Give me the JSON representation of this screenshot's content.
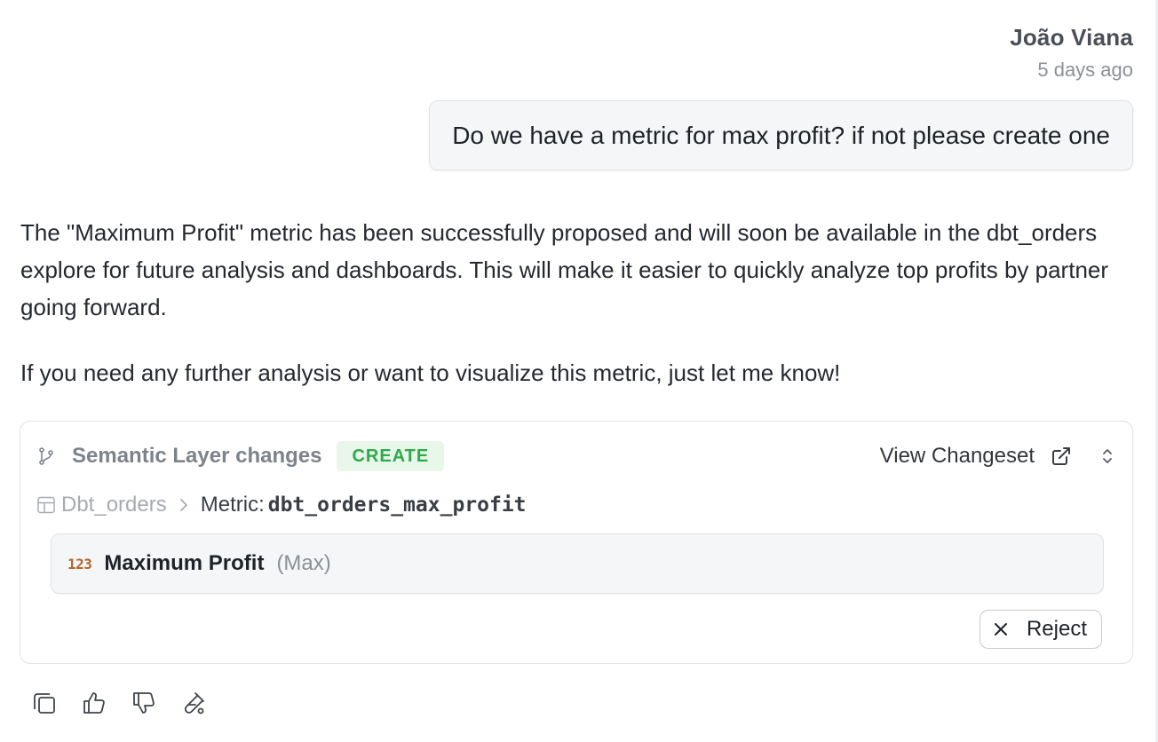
{
  "user_message": {
    "author": "João Viana",
    "timestamp": "5 days ago",
    "text": "Do we have a metric for max profit? if not please create one"
  },
  "assistant_message": {
    "paragraphs": [
      "The \"Maximum Profit\" metric has been successfully proposed and will soon be available in the dbt_orders explore for future analysis and dashboards. This will make it easier to quickly analyze top profits by partner going forward.",
      "If you need any further analysis or want to visualize this metric, just let me know!"
    ]
  },
  "changes_card": {
    "title": "Semantic Layer changes",
    "badge": "CREATE",
    "view_changeset_label": "View Changeset",
    "breadcrumb": {
      "model": "Dbt_orders",
      "kind": "Metric:",
      "name": "dbt_orders_max_profit"
    },
    "metric": {
      "type_icon": "123",
      "label": "Maximum Profit",
      "aggregation": "(Max)"
    },
    "reject_label": "Reject"
  },
  "icons": {
    "branch": "git-branch-icon",
    "external_link": "external-link-icon",
    "expand": "chevron-up-down-icon",
    "table": "table-icon",
    "breadcrumb_separator": "chevron-right-icon",
    "reject": "close-icon",
    "actions": [
      "copy-icon",
      "thumbs-up-icon",
      "thumbs-down-icon",
      "flask-icon"
    ]
  },
  "colors": {
    "badge_bg": "#e8f7ea",
    "badge_text": "#2eaa4a",
    "number_icon": "#b5652a"
  }
}
